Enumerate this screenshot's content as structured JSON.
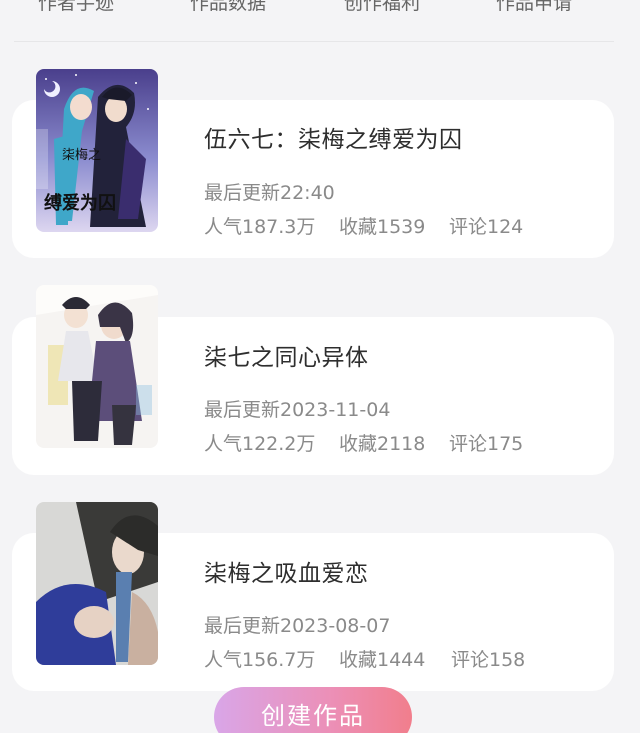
{
  "tabs": [
    {
      "label": "作者手迹"
    },
    {
      "label": "作品数据"
    },
    {
      "label": "创作福利"
    },
    {
      "label": "作品申请"
    }
  ],
  "works": [
    {
      "title": "伍六七：柒梅之缚爱为囚",
      "updated": "最后更新22:40",
      "popularity": "人气187.3万",
      "favorites": "收藏1539",
      "comments": "评论124",
      "cover_text_1": "柒梅之",
      "cover_text_2": "缚爱为囚"
    },
    {
      "title": "柒七之同心异体",
      "updated": "最后更新2023-11-04",
      "popularity": "人气122.2万",
      "favorites": "收藏2118",
      "comments": "评论175"
    },
    {
      "title": "柒梅之吸血爱恋",
      "updated": "最后更新2023-08-07",
      "popularity": "人气156.7万",
      "favorites": "收藏1444",
      "comments": "评论158"
    }
  ],
  "create_button": "创建作品",
  "colors": {
    "background": "#f4f4f6",
    "card": "#ffffff",
    "button_gradient_start": "#d9a6e8",
    "button_gradient_end": "#f17e8c"
  }
}
